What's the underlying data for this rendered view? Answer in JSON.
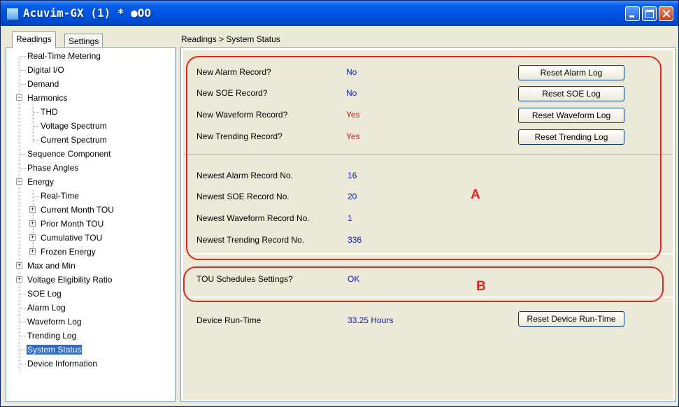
{
  "window": {
    "title": "Acuvim-GX (1) * ●OO"
  },
  "tabs": [
    {
      "label": "Readings"
    },
    {
      "label": "Settings"
    }
  ],
  "breadcrumb": "Readings > System Status",
  "tree": [
    {
      "label": "Real-Time Metering"
    },
    {
      "label": "Digital I/O"
    },
    {
      "label": "Demand"
    },
    {
      "label": "Harmonics"
    },
    {
      "label": "THD"
    },
    {
      "label": "Voltage Spectrum"
    },
    {
      "label": "Current Spectrum"
    },
    {
      "label": "Sequence Component"
    },
    {
      "label": "Phase Angles"
    },
    {
      "label": "Energy"
    },
    {
      "label": "Real-Time"
    },
    {
      "label": "Current Month TOU"
    },
    {
      "label": "Prior Month TOU"
    },
    {
      "label": "Cumulative TOU"
    },
    {
      "label": "Frozen Energy"
    },
    {
      "label": "Max and Min"
    },
    {
      "label": "Voltage Eligibility Ratio"
    },
    {
      "label": "SOE Log"
    },
    {
      "label": "Alarm Log"
    },
    {
      "label": "Waveform Log"
    },
    {
      "label": "Trending Log"
    },
    {
      "label": "System Status"
    },
    {
      "label": "Device Information"
    }
  ],
  "status": {
    "records": [
      {
        "label": "New Alarm Record?",
        "value": "No",
        "value_color": "#0a1fb5",
        "button": "Reset Alarm Log"
      },
      {
        "label": "New SOE Record?",
        "value": "No",
        "value_color": "#0a1fb5",
        "button": "Reset SOE Log"
      },
      {
        "label": "New Waveform Record?",
        "value": "Yes",
        "value_color": "#d41010",
        "button": "Reset Waveform Log"
      },
      {
        "label": "New Trending Record?",
        "value": "Yes",
        "value_color": "#d41010",
        "button": "Reset Trending Log"
      }
    ],
    "numbers": [
      {
        "label": "Newest Alarm Record No.",
        "value": "16"
      },
      {
        "label": "Newest SOE Record No.",
        "value": "20"
      },
      {
        "label": "Newest Waveform Record No.",
        "value": "1"
      },
      {
        "label": "Newest Trending Record No.",
        "value": "336"
      }
    ],
    "tou": {
      "label": "TOU Schedules Settings?",
      "value": "OK"
    },
    "runtime": {
      "label": "Device Run-Time",
      "value": "33.25 Hours",
      "button": "Reset Device Run-Time"
    }
  },
  "annotations": {
    "a": "A",
    "b": "B"
  },
  "colors": {
    "annotation": "#e0261f",
    "value_blue": "#0a1fb5",
    "value_red": "#d41010",
    "selection": "#316ac5"
  }
}
